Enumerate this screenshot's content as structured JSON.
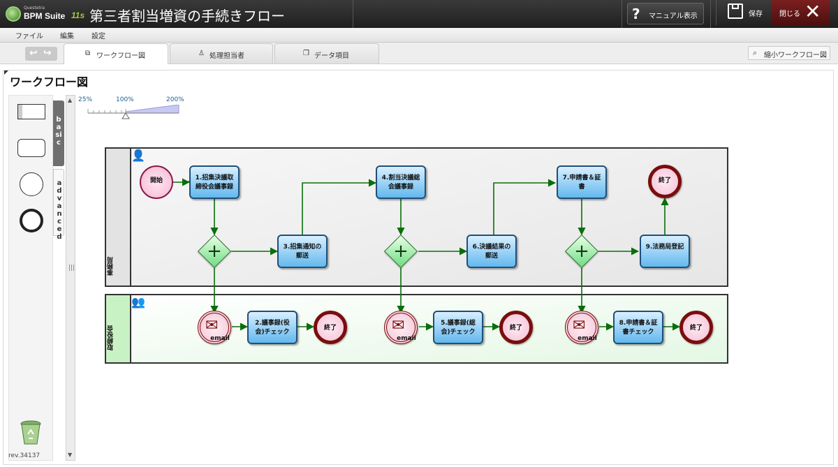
{
  "header": {
    "logo_company": "Questetra",
    "logo_product": "BPM Suite",
    "logo_version": "11s",
    "app_title": "第三者割当増資の手続きフロー",
    "manual_label": "マニュアル表示",
    "save_label": "保存",
    "close_label": "閉じる"
  },
  "menu": {
    "items": [
      "ファイル",
      "編集",
      "設定"
    ]
  },
  "tabs": [
    {
      "label": "ワークフロー図",
      "icon": "workflow-icon",
      "active": true
    },
    {
      "label": "処理担当者",
      "icon": "person-icon",
      "active": false
    },
    {
      "label": "データ項目",
      "icon": "copy-icon",
      "active": false
    }
  ],
  "mini_workflow_label": "縮小ワークフロー図",
  "panel": {
    "title": "ワークフロー図"
  },
  "palette": {
    "basic_label": "basic",
    "advanced_label": "advanced",
    "revision": "rev.34137"
  },
  "zoom": {
    "min_label": "25%",
    "mid_label": "100%",
    "max_label": "200%",
    "level_percent": 100
  },
  "lanes": [
    {
      "name": "事務局",
      "icon": "person-icon"
    },
    {
      "name": "取締役会",
      "icon": "group-icon"
    }
  ],
  "nodes": {
    "start": "開始",
    "t1": "1.招集決議取\n締役会議事録",
    "t3": "3.招集通知の\n郵送",
    "t4": "4.割当決議総\n会議事録",
    "t6": "6.決議結果の\n郵送",
    "t7": "7.申請書＆証\n書",
    "t9": "9.法務局登記",
    "end_top": "終了",
    "t2": "2.議事録(役\n会)チェック",
    "t5": "5.議事録(総\n会)チェック",
    "t8": "8.申請書＆証\n書チェック",
    "end1": "終了",
    "end2": "終了",
    "end3": "終了",
    "email_label": "email"
  },
  "colors": {
    "task_border": "#1f4f78",
    "flow_arrow": "#0a6e0a",
    "end_event": "#7a0d0d",
    "close_button": "#6a1818"
  }
}
